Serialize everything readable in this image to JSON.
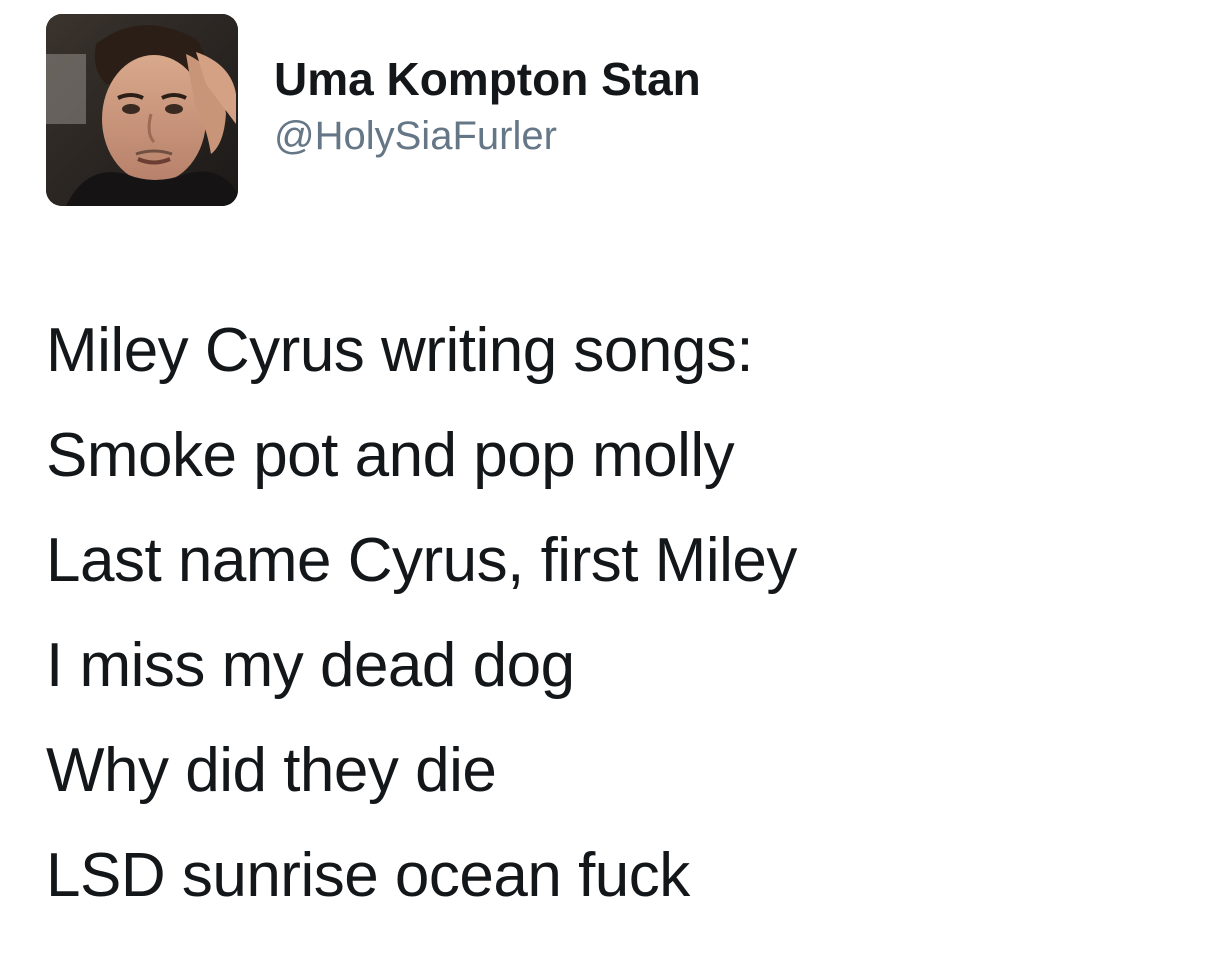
{
  "user": {
    "display_name": "Uma Kompton Stan",
    "handle": "@HolySiaFurler",
    "avatar_icon": "profile-photo"
  },
  "tweet": {
    "lines": [
      "Miley Cyrus writing songs:",
      "Smoke pot and pop molly",
      "Last name Cyrus, first Miley",
      "I miss my dead dog",
      "Why did they die",
      "LSD sunrise ocean fuck"
    ]
  },
  "colors": {
    "text": "#14171a",
    "handle": "#657786",
    "background": "#ffffff"
  }
}
